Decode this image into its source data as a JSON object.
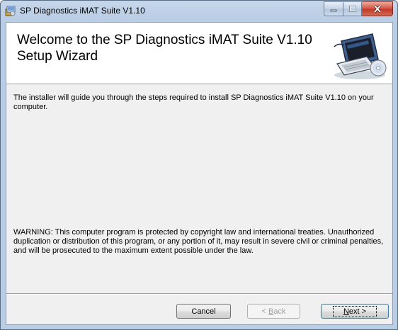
{
  "window": {
    "title": "SP Diagnostics iMAT Suite V1.10",
    "icons": {
      "app": "installer-icon",
      "minimize": "minimize-icon",
      "maximize": "maximize-icon",
      "close": "close-icon"
    }
  },
  "banner": {
    "title": "Welcome to the SP Diagnostics iMAT Suite V1.10 Setup Wizard",
    "art": "computer-with-disc-icon"
  },
  "body": {
    "intro": "The installer will guide you through the steps required to install SP Diagnostics iMAT Suite V1.10 on your computer.",
    "warning": "WARNING: This computer program is protected by copyright law and international treaties. Unauthorized duplication or distribution of this program, or any portion of it, may result in severe civil or criminal penalties, and will be prosecuted to the maximum extent possible under the law."
  },
  "buttons": {
    "cancel": "Cancel",
    "back": {
      "accel": "B",
      "rest": "ack",
      "prefix": "< ",
      "suffix": ""
    },
    "next": {
      "accel": "N",
      "rest": "ext",
      "prefix": "",
      "suffix": " >"
    },
    "back_enabled": false
  },
  "colors": {
    "titlebar": "#b9cde5",
    "close_button": "#c23a2a",
    "dialog_bg": "#f0f0f0"
  }
}
